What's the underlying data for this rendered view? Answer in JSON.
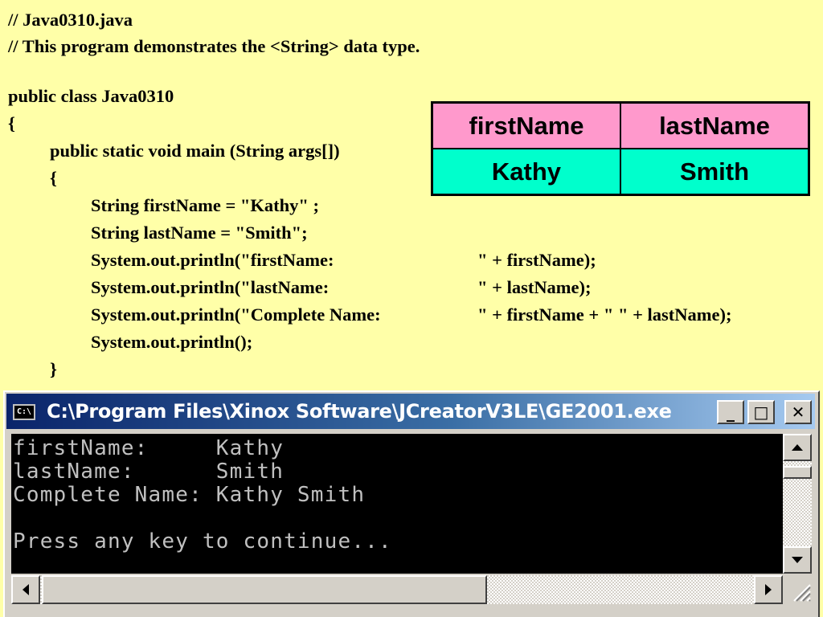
{
  "code": {
    "lines": [
      "// Java0310.java",
      "// This program demonstrates the <String> data type.",
      "public class Java0310",
      "{",
      "public static void main (String args[])",
      "{",
      "String firstName = \"Kathy\" ;",
      "String lastName = \"Smith\";",
      "System.out.println(\"firstName:",
      "System.out.println(\"lastName:",
      "System.out.println(\"Complete Name:",
      "System.out.println();",
      "}"
    ],
    "tails": [
      "\" + firstName);",
      "\" + lastName);",
      "\" + firstName + \" \" + lastName);"
    ]
  },
  "variable_table": {
    "headers": [
      "firstName",
      "lastName"
    ],
    "values": [
      "Kathy",
      "Smith"
    ],
    "header_color": "#ff99cc",
    "value_color": "#00ffcc"
  },
  "console": {
    "title": "C:\\Program Files\\Xinox Software\\JCreatorV3LE\\GE2001.exe",
    "icon": "cmd-icon",
    "icon_text": "C:\\",
    "buttons": {
      "minimize": "_",
      "maximize": "□",
      "close": "✕"
    },
    "output": [
      "firstName:     Kathy",
      "lastName:      Smith",
      "Complete Name: Kathy Smith",
      "",
      "Press any key to continue..."
    ]
  },
  "colors": {
    "slide_background": "#ffffa8",
    "titlebar_start": "#0a246a",
    "titlebar_end": "#a6caf0",
    "terminal_background": "#000000",
    "terminal_text": "#c0c0c0"
  }
}
